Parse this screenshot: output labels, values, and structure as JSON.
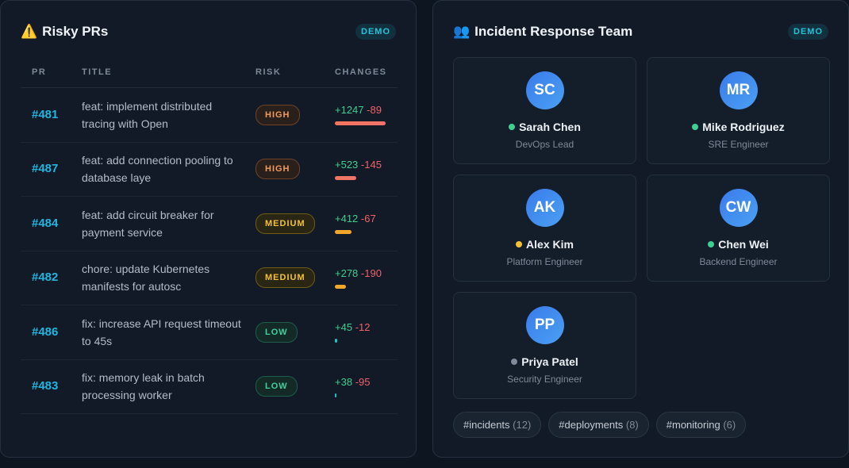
{
  "risky_prs": {
    "icon": "warning-icon",
    "title": "Risky PRs",
    "badge": "DEMO",
    "columns": [
      "PR",
      "TITLE",
      "RISK",
      "CHANGES"
    ],
    "rows": [
      {
        "pr": "#481",
        "title": "feat: implement distributed tracing with Open",
        "risk": "HIGH",
        "risk_level": "high",
        "additions": "+1247",
        "deletions": "-89",
        "bar_fraction": 1.0
      },
      {
        "pr": "#487",
        "title": "feat: add connection pooling to database laye",
        "risk": "HIGH",
        "risk_level": "high",
        "additions": "+523",
        "deletions": "-145",
        "bar_fraction": 0.42
      },
      {
        "pr": "#484",
        "title": "feat: add circuit breaker for payment service",
        "risk": "MEDIUM",
        "risk_level": "medium",
        "additions": "+412",
        "deletions": "-67",
        "bar_fraction": 0.33
      },
      {
        "pr": "#482",
        "title": "chore: update Kubernetes manifests for autosc",
        "risk": "MEDIUM",
        "risk_level": "medium",
        "additions": "+278",
        "deletions": "-190",
        "bar_fraction": 0.22
      },
      {
        "pr": "#486",
        "title": "fix: increase API request timeout to 45s",
        "risk": "LOW",
        "risk_level": "low",
        "additions": "+45",
        "deletions": "-12",
        "bar_fraction": 0.04
      },
      {
        "pr": "#483",
        "title": "fix: memory leak in batch processing worker",
        "risk": "LOW",
        "risk_level": "low",
        "additions": "+38",
        "deletions": "-95",
        "bar_fraction": 0.03
      }
    ]
  },
  "team": {
    "icon": "people-icon",
    "title": "Incident Response Team",
    "badge": "DEMO",
    "members": [
      {
        "initials": "SC",
        "name": "Sarah Chen",
        "role": "DevOps Lead",
        "status": "online",
        "status_color": "#3fcf8e"
      },
      {
        "initials": "MR",
        "name": "Mike Rodriguez",
        "role": "SRE Engineer",
        "status": "online",
        "status_color": "#3fcf8e"
      },
      {
        "initials": "AK",
        "name": "Alex Kim",
        "role": "Platform Engineer",
        "status": "away",
        "status_color": "#f3c233"
      },
      {
        "initials": "CW",
        "name": "Chen Wei",
        "role": "Backend Engineer",
        "status": "online",
        "status_color": "#3fcf8e"
      },
      {
        "initials": "PP",
        "name": "Priya Patel",
        "role": "Security Engineer",
        "status": "offline",
        "status_color": "#7e8a99"
      }
    ],
    "channels": [
      {
        "name": "#incidents",
        "count": "(12)"
      },
      {
        "name": "#deployments",
        "count": "(8)"
      },
      {
        "name": "#monitoring",
        "count": "(6)"
      }
    ]
  },
  "colors": {
    "accent": "#22b5e0",
    "additions": "#3fcf8e",
    "deletions": "#f2616a"
  }
}
